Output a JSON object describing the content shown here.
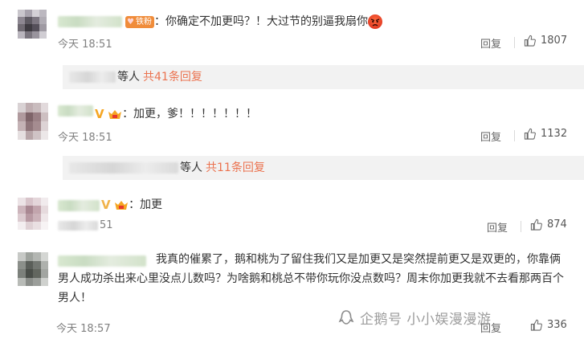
{
  "comments": [
    {
      "text_before_emoji": "：你确定不加更吗？！大过节的别逼我扇你",
      "time": "今天 18:51",
      "reply_label": "回复",
      "likes": "1807",
      "fan_badge": "铁粉",
      "sub_replies": {
        "prefix": "等人",
        "link": "共41条回复"
      }
    },
    {
      "text": "：加更，爹！！！！！！！",
      "time": "今天 18:51",
      "reply_label": "回复",
      "likes": "1132",
      "sub_replies": {
        "prefix": "等人",
        "link": "共11条回复"
      }
    },
    {
      "text": "：加更",
      "time": "今天 18:51",
      "time_visible": "51",
      "reply_label": "回复",
      "likes": "874"
    },
    {
      "text": "我真的催累了，鹅和桃为了留住我们又是加更又是突然提前更又是双更的，你靠俩男人成功杀出来心里没点儿数吗？为啥鹅和桃总不带你玩你没点数吗？周末你加更我就不去看那两百个男人！",
      "time": "今天 18:57",
      "reply_label": "回复",
      "likes": "336"
    }
  ],
  "watermark": {
    "text": "企鹅号 小小娱漫漫游"
  },
  "colors": {
    "link": "#eb7350",
    "vip": "#f5a623",
    "time": "#808080"
  },
  "icons": [
    "thumb-up-icon",
    "vip-v-icon",
    "crown-icon",
    "angry-emoji-icon",
    "penguin-logo-icon"
  ]
}
